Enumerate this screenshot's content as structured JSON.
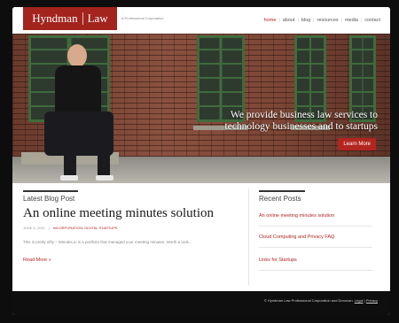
{
  "header": {
    "logo_left": "Hyndman",
    "logo_right": "Law",
    "tagline": "A Professional Corporation",
    "nav": [
      "home",
      "about",
      "blog",
      "resources",
      "media",
      "contact"
    ]
  },
  "hero": {
    "headline_line1": "We provide business law services to",
    "headline_line2": "technology businesses and to startups",
    "button": "Learn More"
  },
  "blog": {
    "section_title": "Latest Blog Post",
    "post_title": "An online meeting minutes solution",
    "post_date": "JUNE 6, 2011",
    "post_categories": "INCORPORATION, DIGITAL STARTUPS",
    "post_excerpt": "This is pretty nifty – Minutes.io is a portfolio that managed your meeting minutes. Worth a look...",
    "read_more": "Read More »"
  },
  "recent": {
    "section_title": "Recent Posts",
    "items": [
      "An online meeting minutes solution",
      "Cloud Computing and Privacy FAQ",
      "Links for Startups"
    ]
  },
  "footer": {
    "copyright": "© Hyndman Law Professional Corporation and Donovan.",
    "legal": "Legal",
    "privacy": "Privacy"
  },
  "colors": {
    "brand": "#a3231d",
    "footer": "#0e0e0e"
  }
}
